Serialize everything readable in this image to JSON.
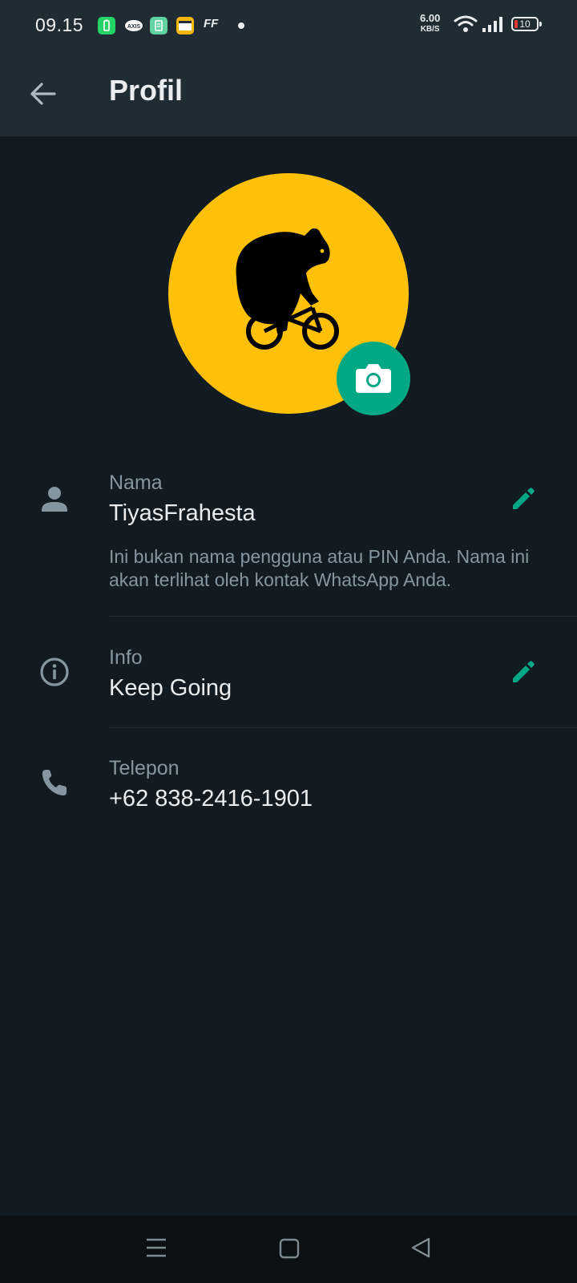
{
  "status_bar": {
    "time": "09.15",
    "speed_value": "6.00",
    "speed_unit": "KB/S",
    "battery_level": "10",
    "notif_ff": "FF"
  },
  "app_bar": {
    "title": "Profil",
    "back_icon": "arrow-left-icon"
  },
  "profile": {
    "avatar_icon": "bear-on-bicycle",
    "avatar_color": "#fec107",
    "camera_icon": "camera-icon",
    "accent_color": "#00a884"
  },
  "name_row": {
    "label": "Nama",
    "value": "TiyasFrahesta",
    "hint": "Ini bukan nama pengguna atau PIN Anda. Nama ini akan terlihat oleh kontak WhatsApp Anda."
  },
  "info_row": {
    "label": "Info",
    "value": "Keep Going"
  },
  "phone_row": {
    "label": "Telepon",
    "value": "+62 838-2416-1901"
  },
  "nav_bar": {
    "icons": [
      "menu-icon",
      "home-icon",
      "back-triangle-icon"
    ]
  }
}
